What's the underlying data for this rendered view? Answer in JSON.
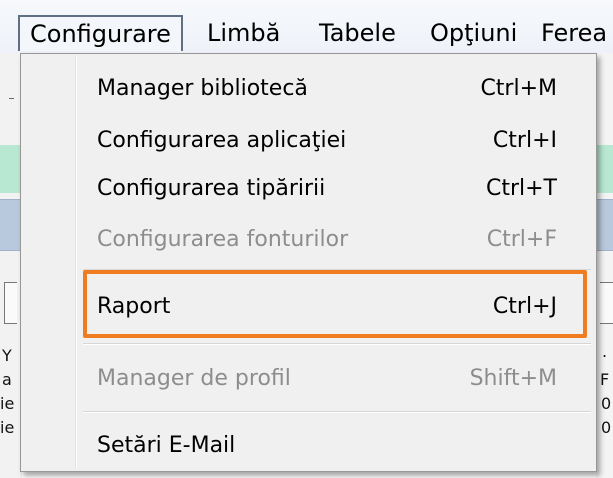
{
  "menubar": {
    "items": [
      "Configurare",
      "Limbă",
      "Tabele",
      "Opţiuni",
      "Ferea"
    ]
  },
  "dropdown": {
    "items": [
      {
        "label": "Manager bibliotecă",
        "shortcut": "Ctrl+M",
        "enabled": true
      },
      {
        "label": "Configurarea aplicaţiei",
        "shortcut": "Ctrl+I",
        "enabled": true
      },
      {
        "label": "Configurarea tipăririi",
        "shortcut": "Ctrl+T",
        "enabled": true
      },
      {
        "label": "Configurarea fonturilor",
        "shortcut": "Ctrl+F",
        "enabled": false
      },
      {
        "label": "Raport",
        "shortcut": "Ctrl+J",
        "enabled": true,
        "highlighted": true
      },
      {
        "label": "Manager de profil",
        "shortcut": "Shift+M",
        "enabled": false
      },
      {
        "label": "Setări E-Mail",
        "shortcut": "",
        "enabled": true
      }
    ]
  },
  "background": {
    "left_glyphs": [
      "Y",
      "a",
      "ie",
      "ie"
    ],
    "right_glyphs": [
      ".",
      "F",
      "0",
      "0"
    ]
  },
  "colors": {
    "highlight_border": "#f07c22",
    "menu_background": "#f0f0f0",
    "disabled_text": "#8d8d8d"
  }
}
